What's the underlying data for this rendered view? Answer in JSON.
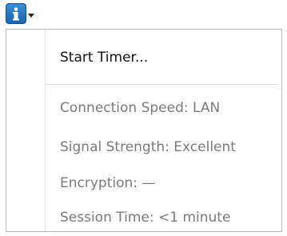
{
  "toolbar": {
    "info_button_icon": "info-icon",
    "info_glyph": "i",
    "accent_color": "#1b6fc2"
  },
  "menu": {
    "start_timer_label": "Start Timer...",
    "connection_speed_label": "Connection Speed: LAN",
    "signal_strength_label": "Signal Strength: Excellent",
    "encryption_label": "Encryption: —",
    "session_time_label": "Session Time: <1 minute"
  }
}
